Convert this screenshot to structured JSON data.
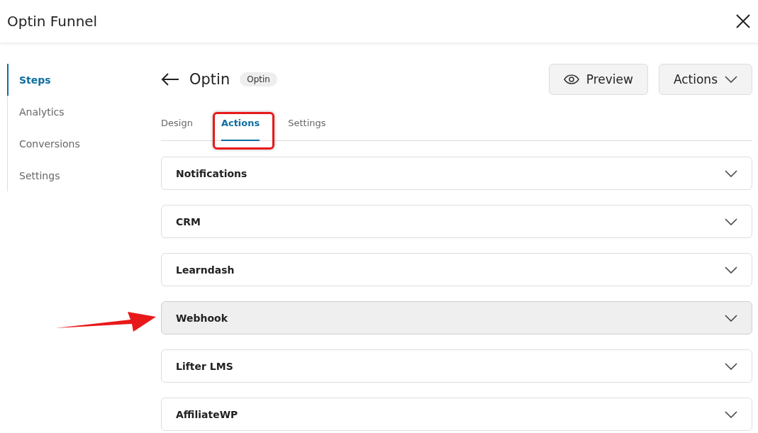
{
  "window": {
    "title": "Optin Funnel"
  },
  "sidebar": {
    "items": [
      {
        "label": "Steps",
        "selected": true
      },
      {
        "label": "Analytics",
        "selected": false
      },
      {
        "label": "Conversions",
        "selected": false
      },
      {
        "label": "Settings",
        "selected": false
      }
    ]
  },
  "step": {
    "title": "Optin",
    "badge": "Optin"
  },
  "buttons": [
    {
      "kind": "preview",
      "label": "Preview"
    },
    {
      "kind": "dropdown",
      "label": "Actions"
    }
  ],
  "tabs": [
    {
      "label": "Design",
      "selected": false
    },
    {
      "label": "Actions",
      "selected": true
    },
    {
      "label": "Settings",
      "selected": false
    }
  ],
  "sections": [
    {
      "label": "Notifications",
      "hovered": false
    },
    {
      "label": "CRM",
      "hovered": false
    },
    {
      "label": "Learndash",
      "hovered": false
    },
    {
      "label": "Webhook",
      "hovered": true
    },
    {
      "label": "Lifter LMS",
      "hovered": false
    },
    {
      "label": "AffiliateWP",
      "hovered": false
    }
  ]
}
